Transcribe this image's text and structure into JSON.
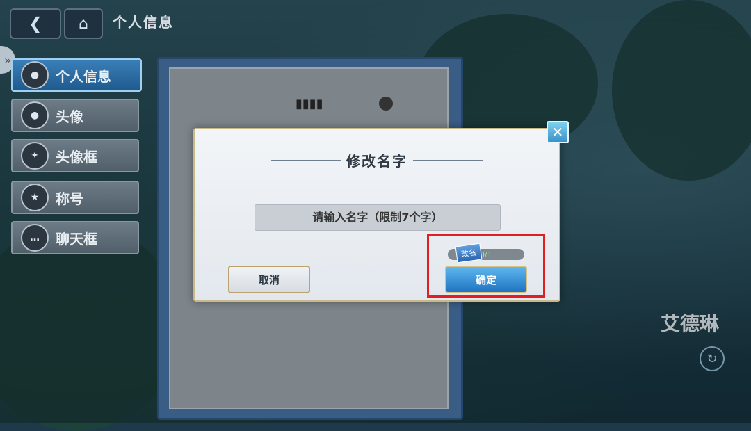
{
  "topbar": {
    "title": "个人信息"
  },
  "sidebar": {
    "items": [
      {
        "label": "个人信息",
        "active": true
      },
      {
        "label": "头像",
        "active": false
      },
      {
        "label": "头像框",
        "active": false
      },
      {
        "label": "称号",
        "active": false
      },
      {
        "label": "聊天框",
        "active": false
      }
    ]
  },
  "character": {
    "name": "艾德琳"
  },
  "dialog": {
    "title": "修改名字",
    "input_placeholder": "请输入名字（限制7个字）",
    "cancel_label": "取消",
    "confirm_label": "确定",
    "rename_badge": "改名",
    "rename_count": "0/1"
  },
  "colors": {
    "accent": "#2f86d0",
    "highlight": "#e02020"
  }
}
